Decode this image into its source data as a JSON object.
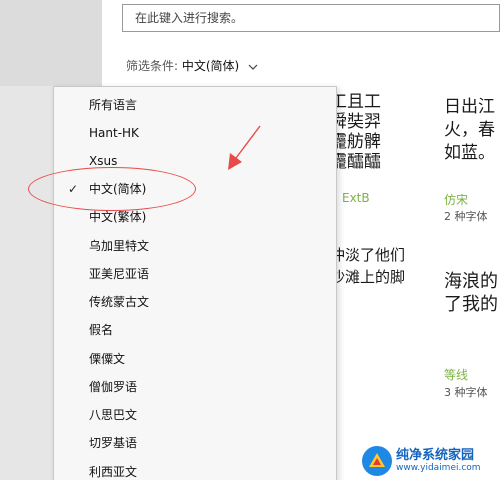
{
  "search": {
    "placeholder": "在此键入进行搜索。"
  },
  "filter": {
    "label": "筛选条件: ",
    "value": "中文(简体)"
  },
  "tiles": [
    {
      "lines": [
        "工且工",
        "舜奘羿",
        "龗舫髀",
        "龗醽醽"
      ]
    },
    {
      "lines": [
        "日出江",
        "火，春",
        "如蓝。"
      ]
    },
    {
      "lines": [
        "冲淡了他们",
        "沙滩上的脚"
      ]
    },
    {
      "lines": [
        "海浪的",
        "了我的"
      ]
    }
  ],
  "fonts": [
    {
      "name": "ExtB",
      "count": ""
    },
    {
      "name": "仿宋",
      "count": "2 种字体"
    },
    {
      "name": "等线",
      "count": "3 种字体"
    }
  ],
  "dropdown": {
    "check_mark": "✓",
    "selected_index": 3,
    "items": [
      "所有语言",
      "Hant-HK",
      "Xsus",
      "中文(简体)",
      "中文(繁体)",
      "乌加里特文",
      "亚美尼亚语",
      "传统蒙古文",
      "假名",
      "傈僳文",
      "僧伽罗语",
      "八思巴文",
      "切罗基语",
      "利西亚文"
    ]
  },
  "watermark": {
    "title": "纯净系统家园",
    "url": "www.yidaimei.com"
  },
  "colors": {
    "accent_green": "#7cb342",
    "annotation_red": "#e84a4a",
    "watermark_blue": "#1565c0"
  },
  "icons": [
    "chevron-down-icon",
    "check-icon",
    "watermark-logo-icon"
  ]
}
